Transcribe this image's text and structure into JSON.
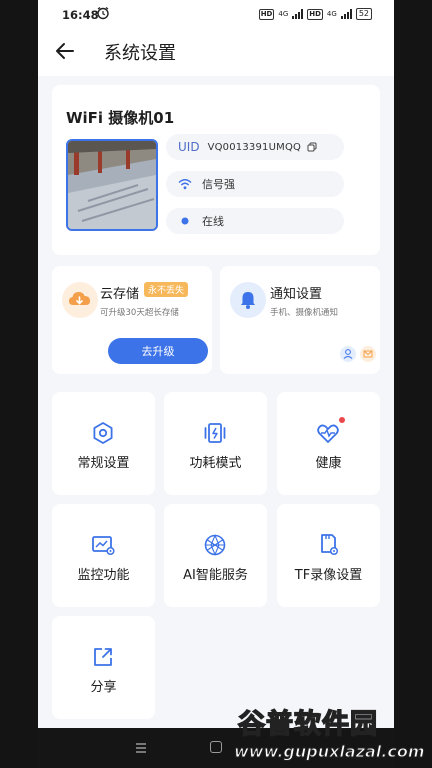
{
  "status_bar": {
    "time": "16:48",
    "battery": "52",
    "network": [
      "HD",
      "4G",
      "HD",
      "4G"
    ]
  },
  "header": {
    "title": "系统设置"
  },
  "camera": {
    "name": "WiFi 摄像机01",
    "uid_label": "UID",
    "uid_value": "VQ0013391UMQQ",
    "signal": "信号强",
    "status": "在线"
  },
  "cloud": {
    "title": "云存储",
    "badge": "永不丢失",
    "subtitle": "可升级30天超长存储",
    "button": "去升级"
  },
  "notify": {
    "title": "通知设置",
    "subtitle": "手机、摄像机通知"
  },
  "grid": {
    "general": "常规设置",
    "power": "功耗模式",
    "health": "健康",
    "monitor": "监控功能",
    "ai": "AI智能服务",
    "tf": "TF录像设置",
    "share": "分享"
  },
  "watermark": {
    "top": "谷普软件园",
    "bottom": "www.gupuxlazal.com"
  },
  "colors": {
    "accent": "#3D73E8",
    "badge": "#F7B85B",
    "alert_dot": "#E9474B",
    "background": "#F4F6FA"
  },
  "icons": {
    "back": "arrow-left-icon",
    "copy": "copy-icon",
    "wifi": "wifi-icon",
    "online": "online-dot-icon",
    "cloud": "cloud-download-icon",
    "bell": "bell-icon",
    "general": "hexagon-gear-icon",
    "power": "battery-mode-icon",
    "health": "heart-pulse-icon",
    "monitor": "monitor-chart-icon",
    "ai": "ai-globe-icon",
    "tf": "sd-card-icon",
    "share": "share-icon"
  }
}
